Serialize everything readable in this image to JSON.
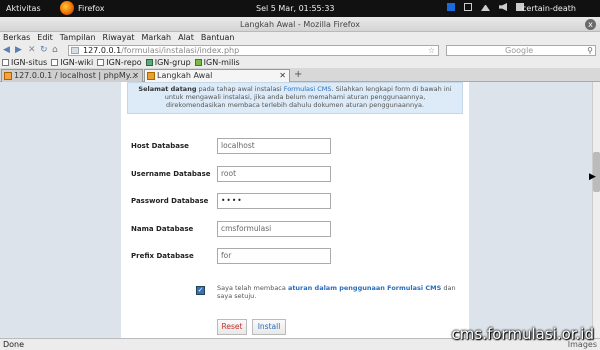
{
  "topbar": {
    "activities": "Aktivitas",
    "app_name": "Firefox",
    "clock": "Sel  5 Mar, 01:55:33",
    "user": "certain-death"
  },
  "window": {
    "title": "Langkah Awal - Mozilla Firefox",
    "close_glyph": "x"
  },
  "menu": [
    "Berkas",
    "Edit",
    "Tampilan",
    "Riwayat",
    "Markah",
    "Alat",
    "Bantuan"
  ],
  "nav": {
    "url": "127.0.0.1",
    "url_rest": "/formulasi/instalasi/index.php",
    "search_engine": "Google"
  },
  "bookmarks": [
    {
      "label": "IGN-situs",
      "icon": "page-icon"
    },
    {
      "label": "IGN-wiki",
      "icon": "page-icon"
    },
    {
      "label": "IGN-repo",
      "icon": "page-icon"
    },
    {
      "label": "IGN-grup",
      "icon": "group-icon"
    },
    {
      "label": "IGN-milis",
      "icon": "mail-icon"
    }
  ],
  "tabs": [
    {
      "label": "127.0.0.1 / localhost | phpMy..."
    },
    {
      "label": "Langkah Awal"
    }
  ],
  "page": {
    "welcome_bold": "Selamat datang",
    "welcome_1": " pada tahap awal instalasi ",
    "welcome_link": "Formulasi CMS",
    "welcome_2": ". Silahkan lengkapi form di bawah ini untuk mengawali instalasi, jika anda belum memahami aturan penggunaannya, direkomendasikan membaca terlebih dahulu dokumen aturan penggunaannya.",
    "fields": [
      {
        "label": "Host Database",
        "value": "localhost"
      },
      {
        "label": "Username Database",
        "value": "root"
      },
      {
        "label": "Password Database",
        "value": "••••"
      },
      {
        "label": "Nama Database",
        "value": "cmsformulasi"
      },
      {
        "label": "Prefix Database",
        "value": "for"
      }
    ],
    "agree_1": "Saya telah membaca ",
    "agree_link": "aturan dalam penggunaan Formulasi CMS",
    "agree_2": " dan saya setuju.",
    "reset_label": "Reset",
    "install_label": "Install"
  },
  "status": {
    "left": "Done",
    "right": "Images"
  },
  "watermark": "cms.formulasi.or.id",
  "colors": {
    "link": "#2a6ebb",
    "reset": "#c0302c",
    "panel_bg": "#dce3ea"
  }
}
